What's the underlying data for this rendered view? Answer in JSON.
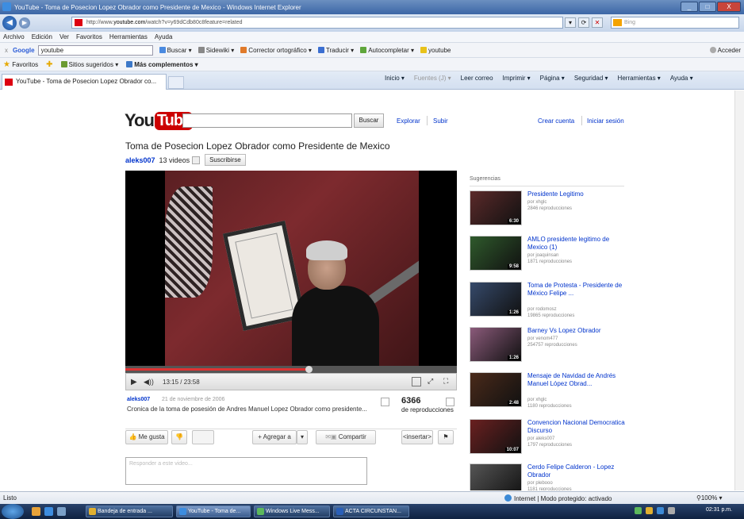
{
  "window": {
    "title": "YouTube - Toma de Posecion Lopez Obrador como Presidente de Mexico - Windows Internet Explorer",
    "controls": [
      "_",
      "□",
      "X"
    ]
  },
  "address": {
    "prefix": "http://www.",
    "domain": "youtube.com",
    "path": "/watch?v=y69dCdb80c8feature=related",
    "search_placeholder": "Bing"
  },
  "menu": [
    "Archivo",
    "Edición",
    "Ver",
    "Favoritos",
    "Herramientas",
    "Ayuda"
  ],
  "google_bar": {
    "close": "x",
    "logo": "Google",
    "query": "youtube",
    "tools": [
      "Buscar ▾",
      "Sidewiki ▾",
      "Corrector ortográfico ▾",
      "Traducir ▾",
      "Autocompletar ▾",
      "youtube"
    ],
    "signin": "Acceder"
  },
  "favorites_bar": {
    "favorites": "Favoritos",
    "suggested": "Sitios sugeridos ▾",
    "more": "Más complementos ▾"
  },
  "tab": {
    "title": "YouTube - Toma de Posecion Lopez Obrador co..."
  },
  "command_bar": [
    "Inicio ▾",
    "Fuentes (J) ▾",
    "Leer correo",
    "Imprimir ▾",
    "Página ▾",
    "Seguridad ▾",
    "Herramientas ▾",
    "Ayuda ▾"
  ],
  "youtube": {
    "logo_you": "You",
    "logo_tube": "Tube",
    "search_button": "Buscar",
    "explore": "Explorar",
    "upload": "Subir",
    "create_account": "Crear cuenta",
    "sign_in": "Iniciar sesión"
  },
  "video": {
    "title": "Toma de Posecion Lopez Obrador como Presidente de Mexico",
    "channel": "aleks007",
    "video_count": "13 videos",
    "subscribe": "Suscribirse",
    "time": "13:15 / 23:58",
    "progress_fraction": 0.553,
    "author": "aleks007",
    "date": "21 de noviembre de 2006",
    "description": "Cronica de la toma de posesión de Andres Manuel Lopez Obrador como presidente...",
    "views": "6366",
    "views_label": "de reproducciones"
  },
  "actions": {
    "like": "Me gusta",
    "add_to": "+ Agregar a",
    "share": "Compartir",
    "embed": "<insertar>",
    "comment_placeholder": "Responder a este video..."
  },
  "suggestions": {
    "heading": "Sugerencias",
    "items": [
      {
        "title": "Presidente Legitimo",
        "by": "por xhglc",
        "views": "2846 reproducciones",
        "duration": "6:30",
        "color": "#5b2a2a"
      },
      {
        "title": "AMLO presidente legitimo de Mexico (1)",
        "by": "por joaquinsan",
        "views": "1871 reproducciones",
        "duration": "9:58",
        "color": "#2f5a2c"
      },
      {
        "title": "Toma de Protesta - Presidente de México Felipe ...",
        "by": "por rodomosz",
        "views": "19865 reproducciones",
        "duration": "1:26",
        "color": "#364a6b"
      },
      {
        "title": "Barney Vs Lopez Obrador",
        "by": "por venom477",
        "views": "254757 reproducciones",
        "duration": "1:26",
        "color": "#8a5a7a"
      },
      {
        "title": "Mensaje de Navidad de Andrés Manuel López Obrad...",
        "by": "por xhglc",
        "views": "1180 reproducciones",
        "duration": "2:48",
        "color": "#4a2a1a"
      },
      {
        "title": "Convencion Nacional Democratica Discurso",
        "by": "por aleks007",
        "views": "1797 reproducciones",
        "duration": "10:07",
        "color": "#6a2020"
      },
      {
        "title": "Cerdo Felipe Calderon - Lopez Obrador",
        "by": "por plebooo",
        "views": "1181 reproducciones",
        "duration": "4:13",
        "color": "#555555"
      }
    ]
  },
  "status": {
    "left": "Listo",
    "zone": "Internet | Modo protegido: activado",
    "zoom": "100%"
  },
  "taskbar": {
    "tasks": [
      "Bandeja de entrada ...",
      "YouTube - Toma de...",
      "Windows Live Mess...",
      "ACTA CIRCUNSTAN..."
    ],
    "clock": "02:31 p.m."
  }
}
